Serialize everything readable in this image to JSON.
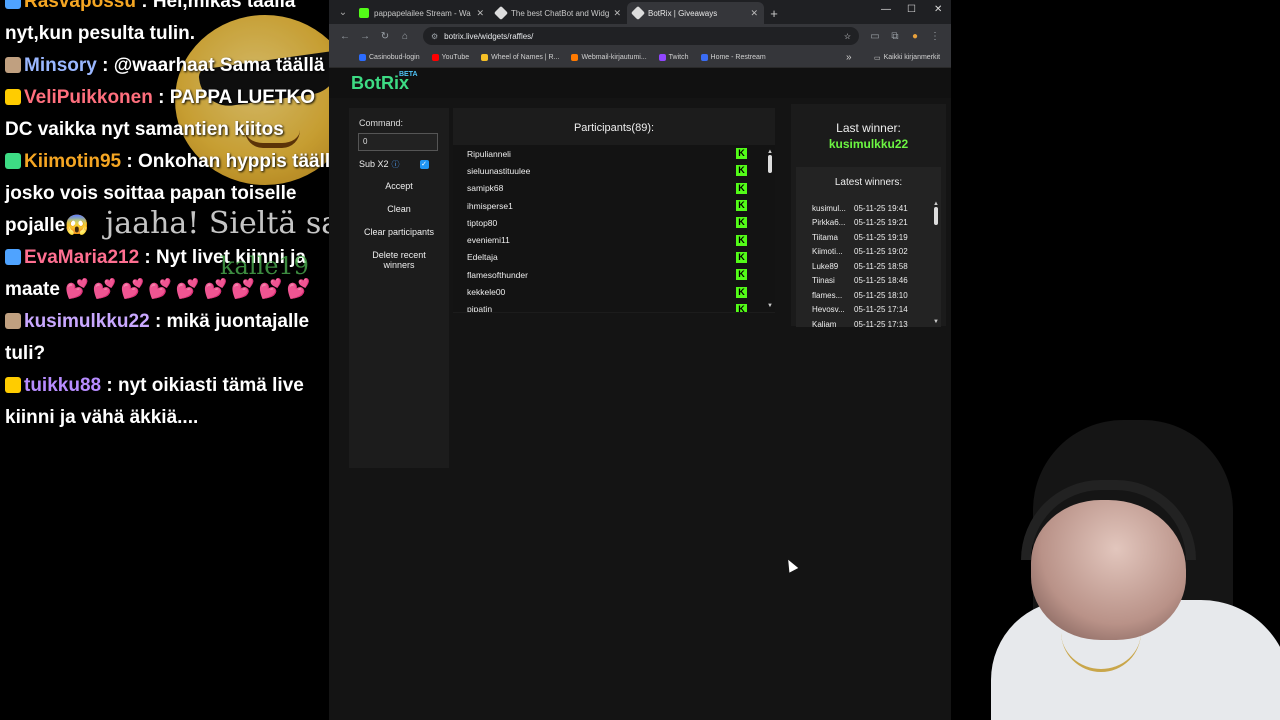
{
  "chat": {
    "messages": [
      {
        "user": "Rasvapossu",
        "color": "#f5a623",
        "text": " : Hei,mikäs täällä nyt,kun pesulta tulin."
      },
      {
        "user": "Minsory",
        "color": "#9ab7ff",
        "text": " : @waarhaat Sama täällä"
      },
      {
        "user": "VeliPuikkonen",
        "color": "#ff6f7d",
        "text": " : PAPPA LUETKO DC vaikka nyt samantien kiitos"
      },
      {
        "user": "Kiimotin95",
        "color": "#f5a623",
        "text": " : Onkohan hyppis täällä josko vois soittaa papan toiselle pojalle😱"
      },
      {
        "user": "EvaMaria212",
        "color": "#ff6f91",
        "text": " : Nyt livet kiinni ja maate",
        "hearts": "💕💕💕💕💕💕💕💕💕"
      },
      {
        "user": "kusimulkku22",
        "color": "#c9a8ff",
        "text": " : mikä juontajalle tuli?"
      },
      {
        "user": "tuikku88",
        "color": "#b78cff",
        "text": " : nyt oikiasti tämä live kiinni ja vähä äkkiä...."
      }
    ],
    "tts_text": "jaaha! Sieltä saapui.....",
    "tts_user": "kalle19"
  },
  "browser": {
    "tabs": [
      {
        "label": "pappapelailee Stream - Wa",
        "color": "#53fc18"
      },
      {
        "label": "The best ChatBot and Widgets",
        "color": "#d0d0d0"
      },
      {
        "label": "BotRix | Giveaways",
        "color": "#d0d0d0"
      }
    ],
    "url": "botrix.live/widgets/raffles/",
    "bookmarks": [
      {
        "label": "Casinobud-login",
        "color": "#2b6cff"
      },
      {
        "label": "YouTube",
        "color": "#ff0000"
      },
      {
        "label": "Wheel of Names | R...",
        "color": "#f6c026"
      },
      {
        "label": "Webmail-kirjautumi...",
        "color": "#ff7a00"
      },
      {
        "label": "Twitch",
        "color": "#9146ff"
      },
      {
        "label": "Home - Restream",
        "color": "#3a6cf4"
      }
    ],
    "all_bookmarks": "Kaikki kirjanmerkit"
  },
  "botrix": {
    "logo": "BotRix",
    "logo_badge": "BETA",
    "command_label": "Command:",
    "command_value": "0",
    "sub_label": "Sub X2",
    "buttons": {
      "accept": "Accept",
      "clean": "Clean",
      "clear_participants": "Clear participants",
      "delete_recent": "Delete recent winners"
    },
    "participants_title": "Participants(89):",
    "participants": [
      "Ripulianneli",
      "sieluunastituulee",
      "samipk68",
      "ihmisperse1",
      "tiptop80",
      "eveniemi11",
      "Edeltaja",
      "flamesofthunder",
      "kekkele00",
      "pipatin"
    ],
    "last_winner_label": "Last winner:",
    "last_winner": "kusimulkku22",
    "latest_winners_label": "Latest winners:",
    "latest_winners": [
      {
        "name": "kusimul...",
        "date": "05-11-25 19:41"
      },
      {
        "name": "Pirkka6...",
        "date": "05-11-25 19:21"
      },
      {
        "name": "Tiitama",
        "date": "05-11-25 19:19"
      },
      {
        "name": "Kiimoti...",
        "date": "05-11-25 19:02"
      },
      {
        "name": "Luke89",
        "date": "05-11-25 18:58"
      },
      {
        "name": "Tiinasi",
        "date": "05-11-25 18:46"
      },
      {
        "name": "flames...",
        "date": "05-11-25 18:10"
      },
      {
        "name": "Hevosv...",
        "date": "05-11-25 17:14"
      },
      {
        "name": "Kaliam",
        "date": "05-11-25 17:13"
      }
    ]
  }
}
